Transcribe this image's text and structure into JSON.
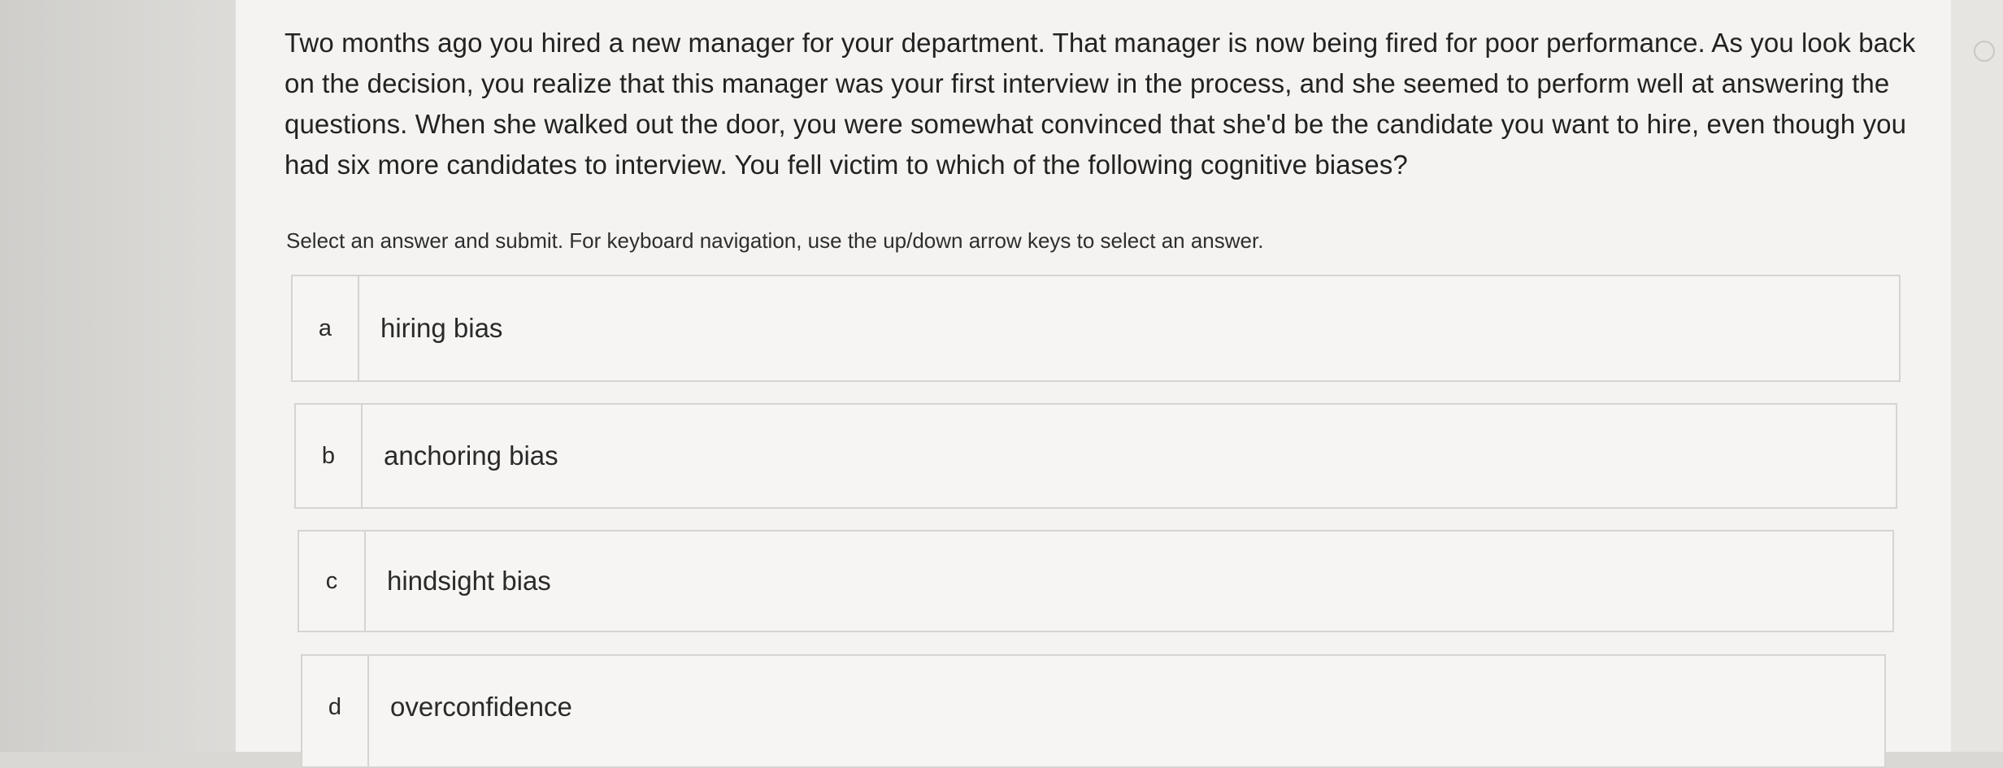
{
  "question": {
    "text": "Two months ago you hired a new manager for your department. That manager is now being fired for poor performance. As you look back on the decision, you realize that this manager was your first interview in the process, and she seemed to perform well at answering the questions. When she walked out the door, you were somewhat convinced that she'd be the candidate you want to hire, even though you had six more candidates to interview. You fell victim to which of the following cognitive biases?"
  },
  "instructions": "Select an answer and submit. For keyboard navigation, use the up/down arrow keys to select an answer.",
  "answers": [
    {
      "letter": "a",
      "label": "hiring bias"
    },
    {
      "letter": "b",
      "label": "anchoring bias"
    },
    {
      "letter": "c",
      "label": "hindsight bias"
    },
    {
      "letter": "d",
      "label": "overconfidence"
    }
  ]
}
